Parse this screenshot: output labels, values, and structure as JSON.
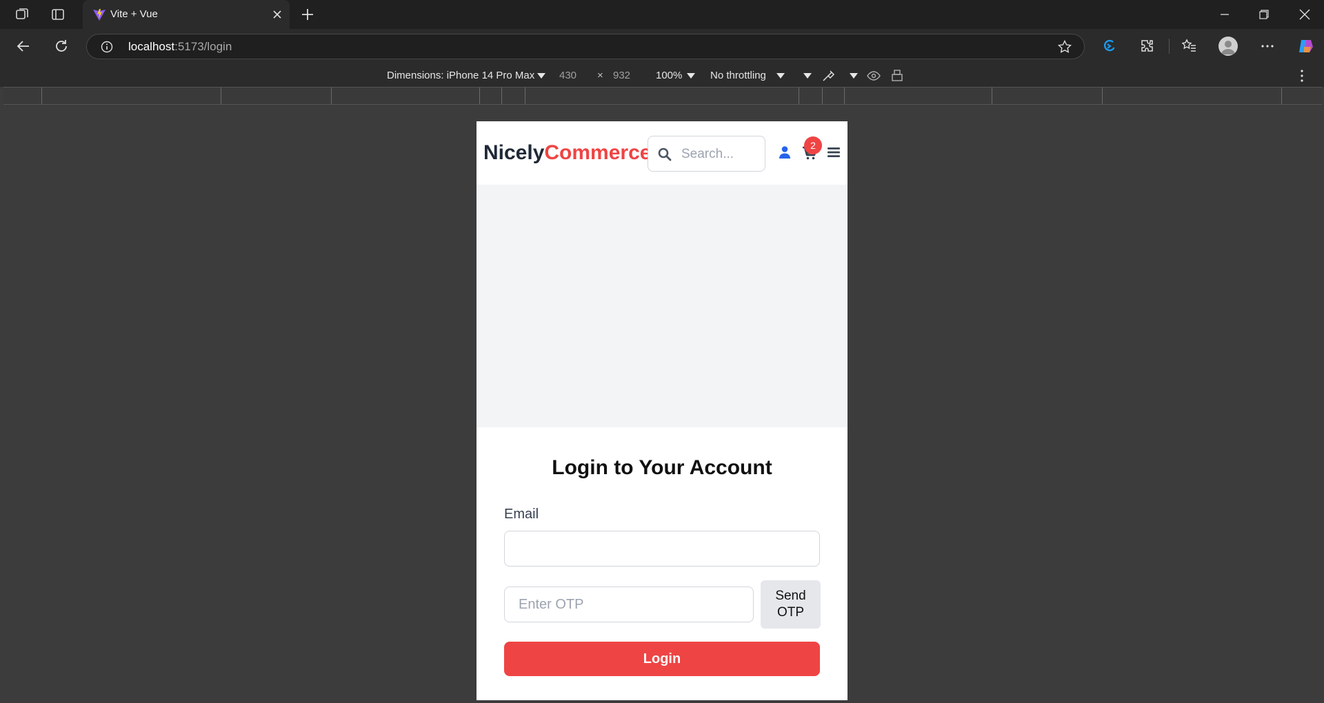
{
  "browser": {
    "tab_title": "Vite + Vue",
    "address_host": "localhost",
    "address_path": ":5173/login"
  },
  "devtools": {
    "dimensions_label": "Dimensions: iPhone 14 Pro Max",
    "width": "430",
    "times": "×",
    "height": "932",
    "zoom": "100%",
    "throttling": "No throttling"
  },
  "site": {
    "logo_part1": "Nicely",
    "logo_part2": "Commerce",
    "search_placeholder": "Search...",
    "cart_count": "2"
  },
  "login": {
    "title": "Login to Your Account",
    "email_label": "Email",
    "email_value": "",
    "otp_placeholder": "Enter OTP",
    "send_otp_label": "Send OTP",
    "login_label": "Login"
  },
  "colors": {
    "brand_dark": "#1f2937",
    "brand_accent": "#ef4444",
    "banner_bg": "#f3f4f6",
    "user_icon": "#2563eb"
  }
}
